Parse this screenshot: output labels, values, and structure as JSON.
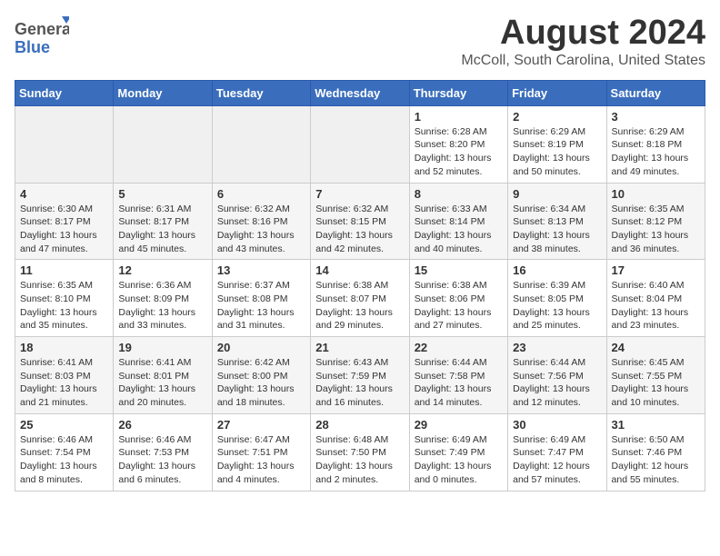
{
  "header": {
    "logo": {
      "line1": "General",
      "line2": "Blue"
    },
    "title": "August 2024",
    "location": "McColl, South Carolina, United States"
  },
  "weekdays": [
    "Sunday",
    "Monday",
    "Tuesday",
    "Wednesday",
    "Thursday",
    "Friday",
    "Saturday"
  ],
  "weeks": [
    [
      {
        "day": "",
        "info": ""
      },
      {
        "day": "",
        "info": ""
      },
      {
        "day": "",
        "info": ""
      },
      {
        "day": "",
        "info": ""
      },
      {
        "day": "1",
        "info": "Sunrise: 6:28 AM\nSunset: 8:20 PM\nDaylight: 13 hours\nand 52 minutes."
      },
      {
        "day": "2",
        "info": "Sunrise: 6:29 AM\nSunset: 8:19 PM\nDaylight: 13 hours\nand 50 minutes."
      },
      {
        "day": "3",
        "info": "Sunrise: 6:29 AM\nSunset: 8:18 PM\nDaylight: 13 hours\nand 49 minutes."
      }
    ],
    [
      {
        "day": "4",
        "info": "Sunrise: 6:30 AM\nSunset: 8:17 PM\nDaylight: 13 hours\nand 47 minutes."
      },
      {
        "day": "5",
        "info": "Sunrise: 6:31 AM\nSunset: 8:17 PM\nDaylight: 13 hours\nand 45 minutes."
      },
      {
        "day": "6",
        "info": "Sunrise: 6:32 AM\nSunset: 8:16 PM\nDaylight: 13 hours\nand 43 minutes."
      },
      {
        "day": "7",
        "info": "Sunrise: 6:32 AM\nSunset: 8:15 PM\nDaylight: 13 hours\nand 42 minutes."
      },
      {
        "day": "8",
        "info": "Sunrise: 6:33 AM\nSunset: 8:14 PM\nDaylight: 13 hours\nand 40 minutes."
      },
      {
        "day": "9",
        "info": "Sunrise: 6:34 AM\nSunset: 8:13 PM\nDaylight: 13 hours\nand 38 minutes."
      },
      {
        "day": "10",
        "info": "Sunrise: 6:35 AM\nSunset: 8:12 PM\nDaylight: 13 hours\nand 36 minutes."
      }
    ],
    [
      {
        "day": "11",
        "info": "Sunrise: 6:35 AM\nSunset: 8:10 PM\nDaylight: 13 hours\nand 35 minutes."
      },
      {
        "day": "12",
        "info": "Sunrise: 6:36 AM\nSunset: 8:09 PM\nDaylight: 13 hours\nand 33 minutes."
      },
      {
        "day": "13",
        "info": "Sunrise: 6:37 AM\nSunset: 8:08 PM\nDaylight: 13 hours\nand 31 minutes."
      },
      {
        "day": "14",
        "info": "Sunrise: 6:38 AM\nSunset: 8:07 PM\nDaylight: 13 hours\nand 29 minutes."
      },
      {
        "day": "15",
        "info": "Sunrise: 6:38 AM\nSunset: 8:06 PM\nDaylight: 13 hours\nand 27 minutes."
      },
      {
        "day": "16",
        "info": "Sunrise: 6:39 AM\nSunset: 8:05 PM\nDaylight: 13 hours\nand 25 minutes."
      },
      {
        "day": "17",
        "info": "Sunrise: 6:40 AM\nSunset: 8:04 PM\nDaylight: 13 hours\nand 23 minutes."
      }
    ],
    [
      {
        "day": "18",
        "info": "Sunrise: 6:41 AM\nSunset: 8:03 PM\nDaylight: 13 hours\nand 21 minutes."
      },
      {
        "day": "19",
        "info": "Sunrise: 6:41 AM\nSunset: 8:01 PM\nDaylight: 13 hours\nand 20 minutes."
      },
      {
        "day": "20",
        "info": "Sunrise: 6:42 AM\nSunset: 8:00 PM\nDaylight: 13 hours\nand 18 minutes."
      },
      {
        "day": "21",
        "info": "Sunrise: 6:43 AM\nSunset: 7:59 PM\nDaylight: 13 hours\nand 16 minutes."
      },
      {
        "day": "22",
        "info": "Sunrise: 6:44 AM\nSunset: 7:58 PM\nDaylight: 13 hours\nand 14 minutes."
      },
      {
        "day": "23",
        "info": "Sunrise: 6:44 AM\nSunset: 7:56 PM\nDaylight: 13 hours\nand 12 minutes."
      },
      {
        "day": "24",
        "info": "Sunrise: 6:45 AM\nSunset: 7:55 PM\nDaylight: 13 hours\nand 10 minutes."
      }
    ],
    [
      {
        "day": "25",
        "info": "Sunrise: 6:46 AM\nSunset: 7:54 PM\nDaylight: 13 hours\nand 8 minutes."
      },
      {
        "day": "26",
        "info": "Sunrise: 6:46 AM\nSunset: 7:53 PM\nDaylight: 13 hours\nand 6 minutes."
      },
      {
        "day": "27",
        "info": "Sunrise: 6:47 AM\nSunset: 7:51 PM\nDaylight: 13 hours\nand 4 minutes."
      },
      {
        "day": "28",
        "info": "Sunrise: 6:48 AM\nSunset: 7:50 PM\nDaylight: 13 hours\nand 2 minutes."
      },
      {
        "day": "29",
        "info": "Sunrise: 6:49 AM\nSunset: 7:49 PM\nDaylight: 13 hours\nand 0 minutes."
      },
      {
        "day": "30",
        "info": "Sunrise: 6:49 AM\nSunset: 7:47 PM\nDaylight: 12 hours\nand 57 minutes."
      },
      {
        "day": "31",
        "info": "Sunrise: 6:50 AM\nSunset: 7:46 PM\nDaylight: 12 hours\nand 55 minutes."
      }
    ]
  ]
}
